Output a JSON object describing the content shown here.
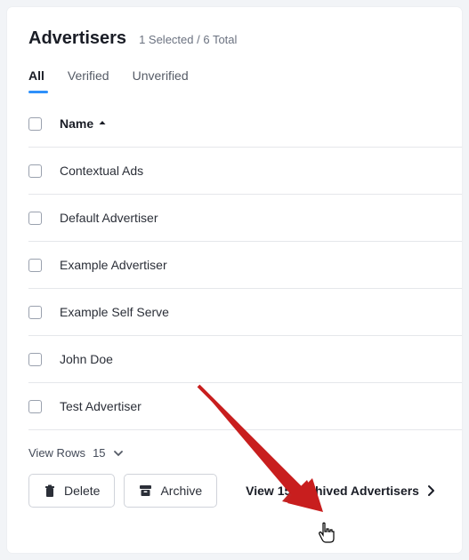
{
  "header": {
    "title": "Advertisers",
    "selection_status": "1 Selected / 6 Total"
  },
  "tabs": [
    {
      "label": "All",
      "active": true
    },
    {
      "label": "Verified",
      "active": false
    },
    {
      "label": "Unverified",
      "active": false
    }
  ],
  "columns": {
    "name": "Name"
  },
  "rows": [
    {
      "name": "Contextual Ads"
    },
    {
      "name": "Default Advertiser"
    },
    {
      "name": "Example Advertiser"
    },
    {
      "name": "Example Self Serve"
    },
    {
      "name": "John Doe"
    },
    {
      "name": "Test Advertiser"
    }
  ],
  "footer": {
    "view_rows_label": "View Rows",
    "view_rows_value": "15",
    "delete_label": "Delete",
    "archive_label": "Archive",
    "archived_link": "View 15 Archived Advertisers"
  },
  "colors": {
    "accent": "#2e90fa",
    "arrow": "#d11010"
  }
}
